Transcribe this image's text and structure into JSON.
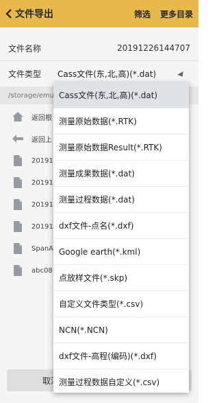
{
  "header": {
    "title": "文件导出",
    "filter_label": "筛选",
    "more_label": "更多目录"
  },
  "form": {
    "filename_label": "文件名称",
    "filename_value": "20191226144707",
    "filetype_label": "文件类型",
    "filetype_value": "Cass文件(东,北,高)(*.dat)"
  },
  "path": "/storage/emu",
  "files": [
    {
      "icon": "home-icon",
      "name": "返回根"
    },
    {
      "icon": "back-arrow-icon",
      "name": "返回上"
    },
    {
      "icon": "file-icon",
      "name": "20191"
    },
    {
      "icon": "file-icon",
      "name": "20191"
    },
    {
      "icon": "file-icon",
      "name": "20191"
    },
    {
      "icon": "file-icon",
      "name": "20191"
    },
    {
      "icon": "file-icon",
      "name": "SpanA"
    },
    {
      "icon": "file-icon",
      "name": "abc08"
    }
  ],
  "bottom": {
    "cancel_label": "取消"
  },
  "dropdown": {
    "selected_index": 0,
    "options": [
      "Cass文件(东,北,高)(*.dat)",
      "测量原始数据(*.RTK)",
      "测量原始数据Result(*.RTK)",
      "测量成果数据(*.dat)",
      "测量过程数据(*.dat)",
      "dxf文件-点名(*.dxf)",
      "Google earth(*.kml)",
      "点放样文件(*.skp)",
      "自定义文件类型(*.csv)",
      "NCN(*.NCN)",
      "dxf文件-高程(编码)(*.dxf)",
      "测量过程数据自定义(*.csv)"
    ]
  },
  "colors": {
    "header_bg": "#f2c14e",
    "selected_bg": "#dfe3e8"
  }
}
